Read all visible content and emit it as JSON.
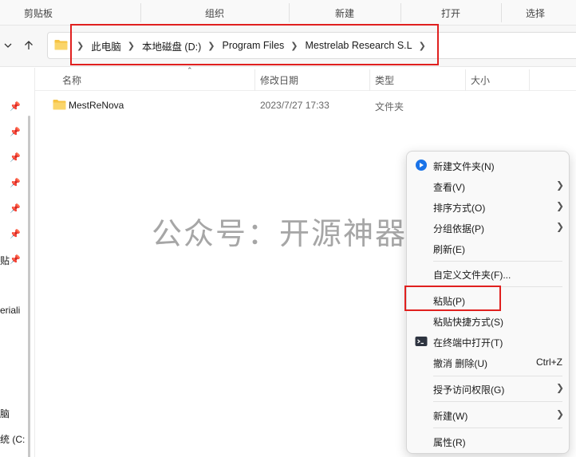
{
  "ribbon": {
    "groups": [
      "剪贴板",
      "组织",
      "新建",
      "打开",
      "选择"
    ]
  },
  "address": {
    "crumbs": [
      "此电脑",
      "本地磁盘 (D:)",
      "Program Files",
      "Mestrelab Research S.L"
    ]
  },
  "nav": {
    "fragments": [
      "贴",
      "eriali",
      "脑",
      "统 (C:"
    ]
  },
  "list": {
    "headers": [
      "名称",
      "修改日期",
      "类型",
      "大小"
    ],
    "rows": [
      {
        "name": "MestReNova",
        "date": "2023/7/27 17:33",
        "type": "文件夹",
        "size": ""
      }
    ]
  },
  "watermark": "公众号：开源神器",
  "context_menu": {
    "new_folder": "新建文件夹(N)",
    "view": "查看(V)",
    "sort": "排序方式(O)",
    "group": "分组依据(P)",
    "refresh": "刷新(E)",
    "customize": "自定义文件夹(F)...",
    "paste": "粘贴(P)",
    "paste_shortcut": "粘贴快捷方式(S)",
    "open_terminal": "在终端中打开(T)",
    "undo_delete": "撤消 删除(U)",
    "undo_shortcut": "Ctrl+Z",
    "grant_access": "授予访问权限(G)",
    "new": "新建(W)",
    "properties": "属性(R)"
  },
  "colors": {
    "highlight": "#e0201f",
    "folder": "#f6c343",
    "accent": "#1a73e8"
  }
}
